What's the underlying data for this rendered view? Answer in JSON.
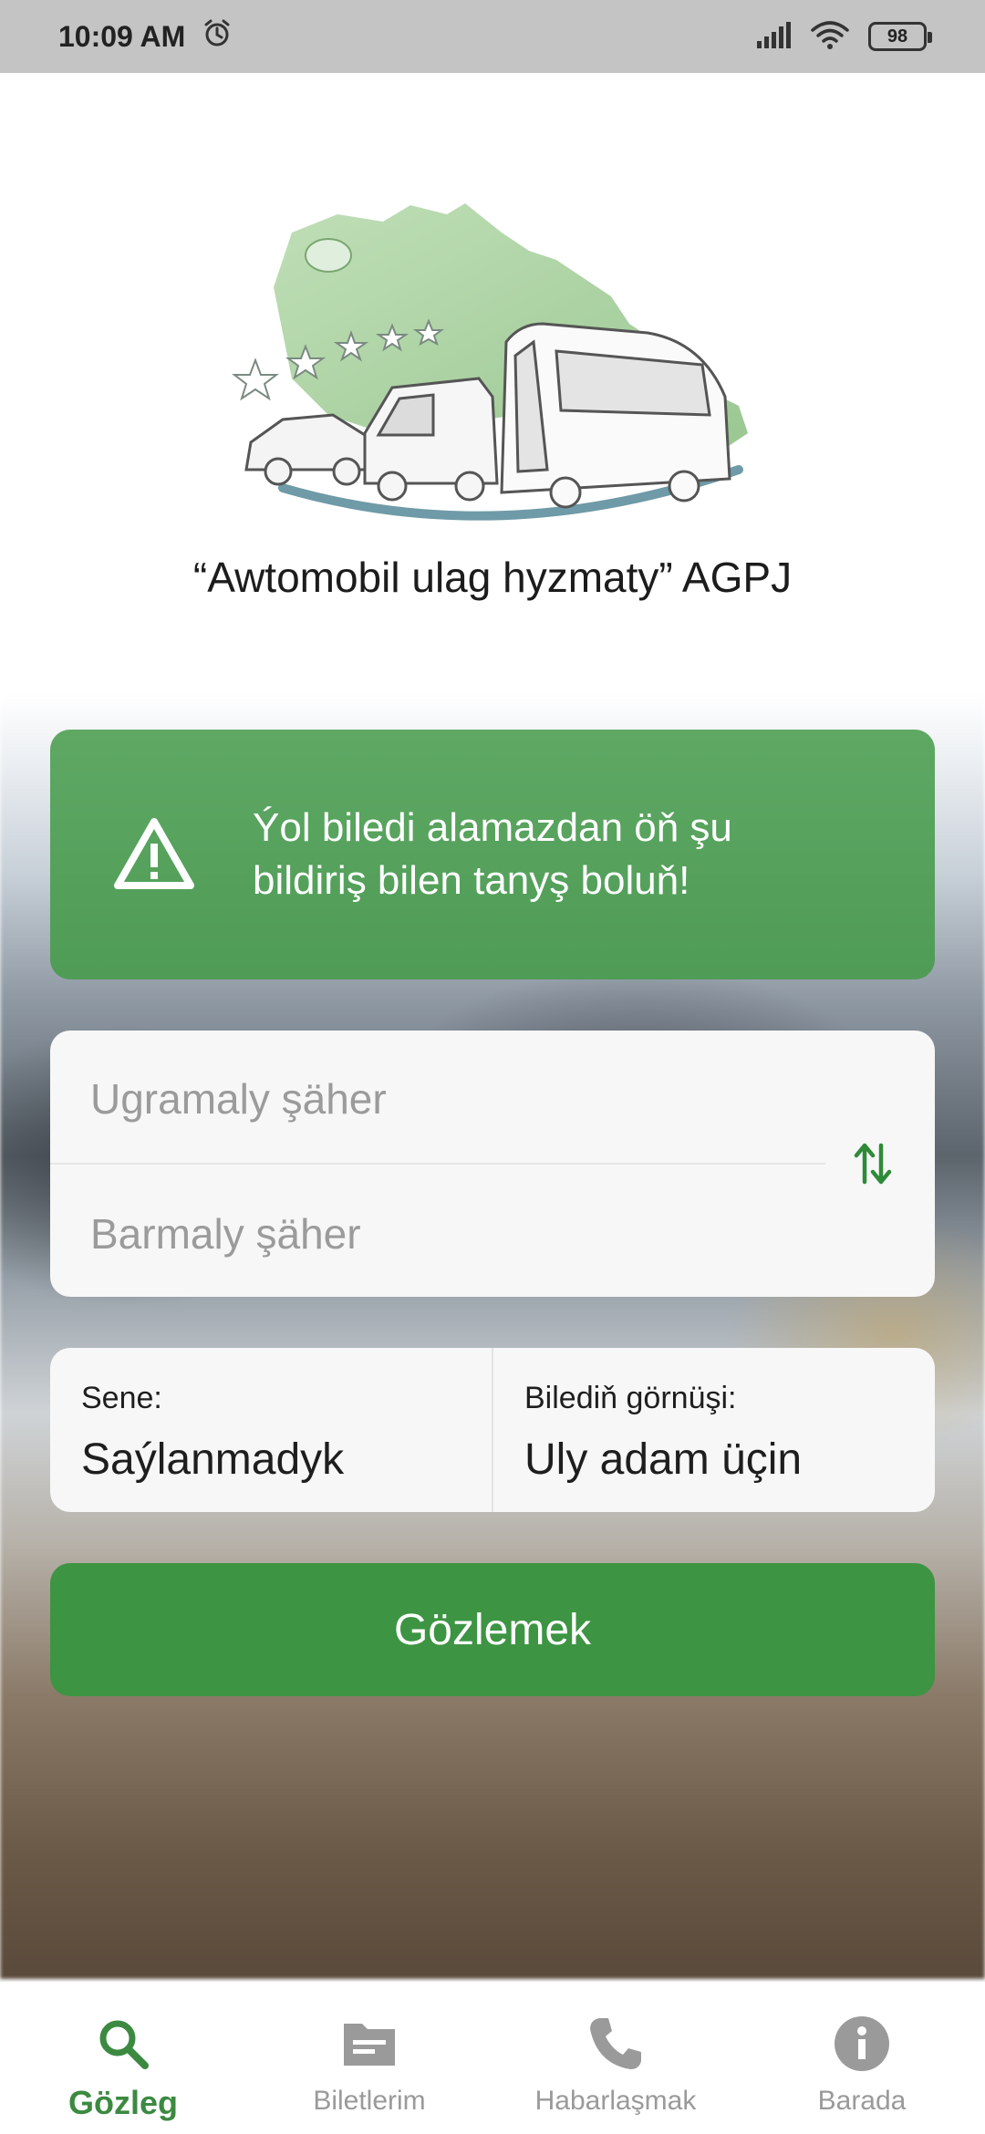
{
  "status_bar": {
    "time": "10:09 AM",
    "battery": "98",
    "icons": [
      "alarm-icon",
      "signal-icon",
      "wifi-icon",
      "battery-icon"
    ]
  },
  "header": {
    "logo": "agpj-logo",
    "company_title": "“Awtomobil ulag hyzmaty” AGPJ"
  },
  "notice": {
    "icon": "warning-icon",
    "text_line1": "Ýol biledi alamazdan öň şu",
    "text_line2": "bildiriş bilen tanyş boluň!"
  },
  "route": {
    "from_placeholder": "Ugramaly şäher",
    "to_placeholder": "Barmaly şäher",
    "swap_icon": "swap-vertical-icon"
  },
  "options": {
    "date_label": "Sene:",
    "date_value": "Saýlanmadyk",
    "ticket_type_label": "Bilediň görnüşi:",
    "ticket_type_value": "Uly adam üçin"
  },
  "search_button": {
    "label": "Gözlemek"
  },
  "bottom_nav": {
    "items": [
      {
        "label": "Gözleg",
        "icon": "search-icon",
        "active": true
      },
      {
        "label": "Biletlerim",
        "icon": "ticket-folder-icon",
        "active": false
      },
      {
        "label": "Habarlaşmak",
        "icon": "phone-icon",
        "active": false
      },
      {
        "label": "Barada",
        "icon": "info-icon",
        "active": false
      }
    ]
  },
  "colors": {
    "accent_green": "#3d9443",
    "notice_green": "#57a25d",
    "nav_active": "#3c8a41",
    "nav_inactive": "#9a9a9a",
    "status_bar": "#c4c4c4"
  }
}
